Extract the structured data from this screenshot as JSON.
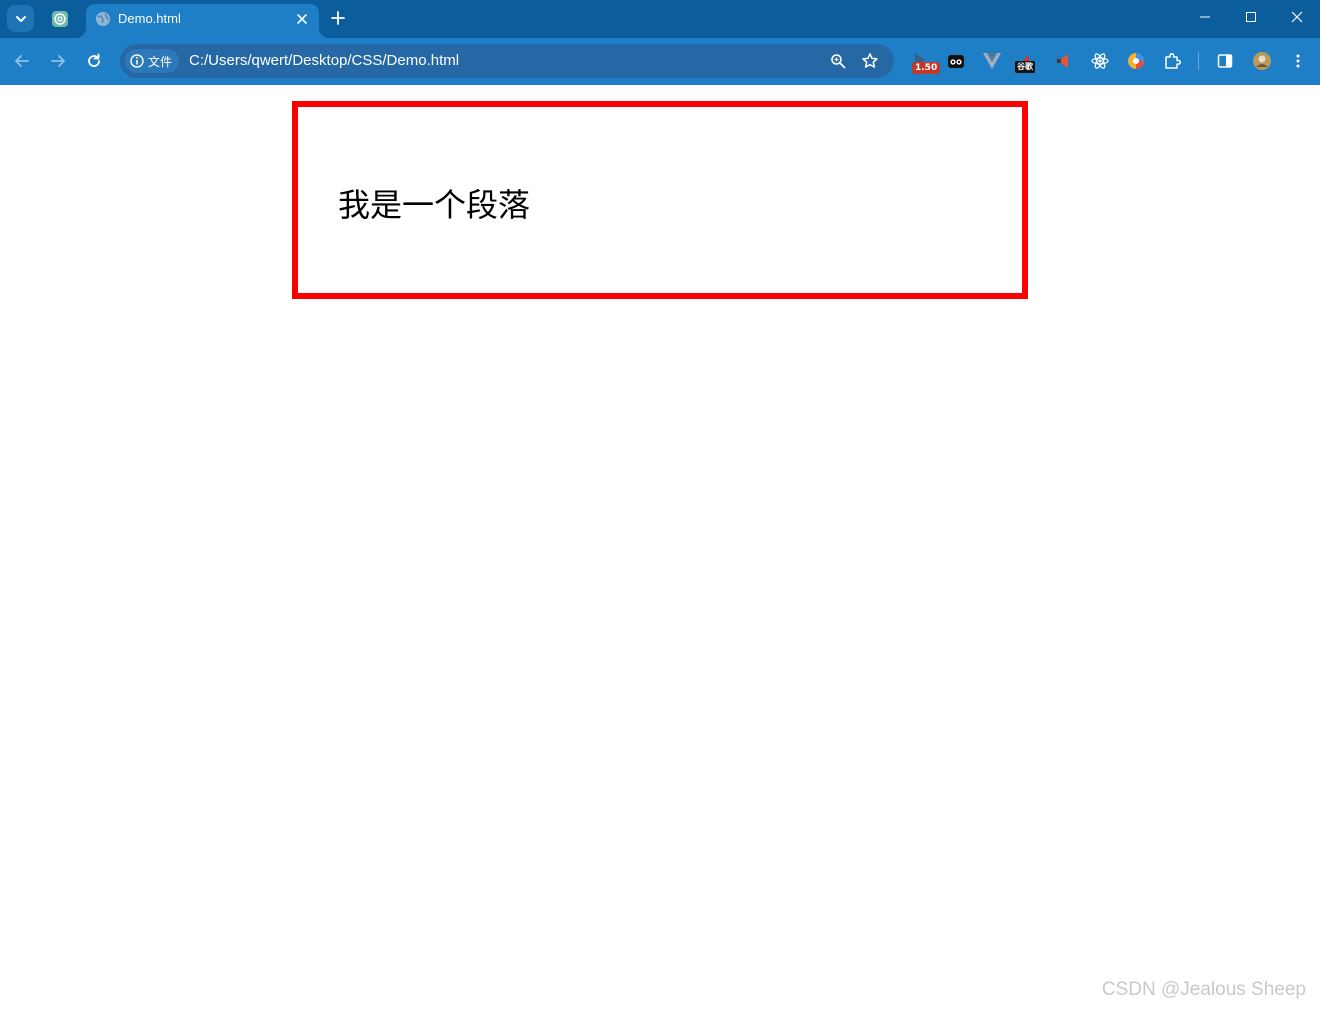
{
  "browser": {
    "tab": {
      "title": "Demo.html"
    },
    "address_bar": {
      "security_chip": "文件",
      "url": "C:/Users/qwert/Desktop/CSS/Demo.html"
    },
    "extensions": [
      {
        "name": "video-speed-extension",
        "badge": "1.50"
      },
      {
        "name": "mask-extension"
      },
      {
        "name": "vue-devtools-extension"
      },
      {
        "name": "google-extension",
        "badge": "谷歌"
      },
      {
        "name": "megaphone-extension"
      },
      {
        "name": "react-devtools-extension"
      },
      {
        "name": "color-picker-extension"
      }
    ],
    "colors": {
      "tabstrip": "#0b5d9c",
      "toolbar": "#1e7fc6",
      "omnibox": "#2568a5"
    }
  },
  "page": {
    "paragraph": "我是一个段落",
    "box_border_color": "#ff0000"
  },
  "watermark": "CSDN @Jealous Sheep"
}
